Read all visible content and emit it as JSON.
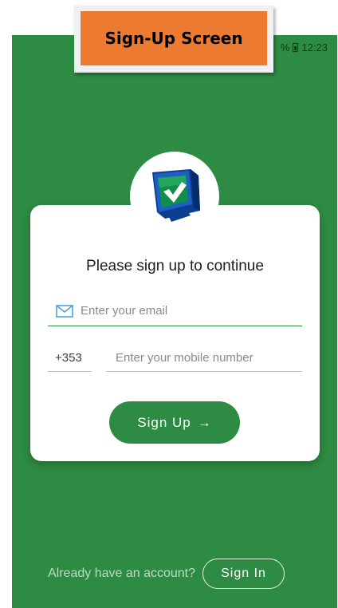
{
  "banner": {
    "title": "Sign-Up Screen"
  },
  "status_bar": {
    "battery_text": "%",
    "time": "12:23"
  },
  "card": {
    "title": "Please sign up to continue",
    "email_placeholder": "Enter your email",
    "country_code": "+353",
    "mobile_placeholder": "Enter your mobile number",
    "signup_label": "Sign Up",
    "signup_arrow": "→"
  },
  "footer": {
    "question": "Already have an account?",
    "signin_label": "Sign In"
  },
  "colors": {
    "background": "#2e8b43",
    "accent": "#2e8b43",
    "banner": "#ec7b31",
    "card": "#ffffff"
  },
  "icons": [
    "monitor-check-logo",
    "mail-icon",
    "arrow-right-icon",
    "battery-icon"
  ]
}
